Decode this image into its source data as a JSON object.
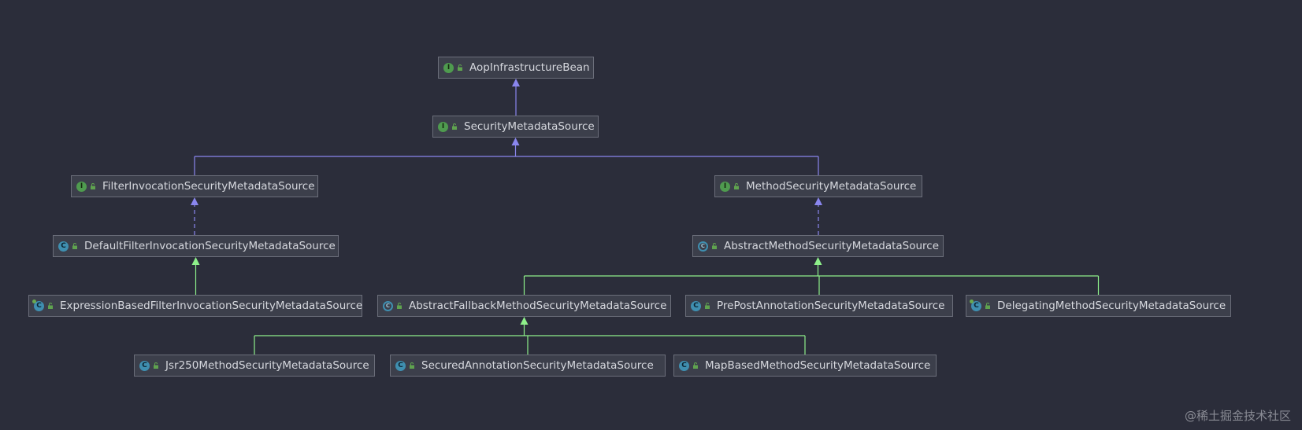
{
  "diagram": {
    "nodes": [
      {
        "id": "aop",
        "name": "AopInfrastructureBean",
        "kind": "interface",
        "kind_letter": "I"
      },
      {
        "id": "sms",
        "name": "SecurityMetadataSource",
        "kind": "interface",
        "kind_letter": "I"
      },
      {
        "id": "fism",
        "name": "FilterInvocationSecurityMetadataSource",
        "kind": "interface",
        "kind_letter": "I"
      },
      {
        "id": "msms",
        "name": "MethodSecurityMetadataSource",
        "kind": "interface",
        "kind_letter": "I"
      },
      {
        "id": "dfism",
        "name": "DefaultFilterInvocationSecurityMetadataSource",
        "kind": "class",
        "kind_letter": "C"
      },
      {
        "id": "amsms",
        "name": "AbstractMethodSecurityMetadataSource",
        "kind": "abstract",
        "kind_letter": "C"
      },
      {
        "id": "ebfism",
        "name": "ExpressionBasedFilterInvocationSecurityMetadataSource",
        "kind": "spring-class",
        "kind_letter": "C"
      },
      {
        "id": "afmsms",
        "name": "AbstractFallbackMethodSecurityMetadataSource",
        "kind": "abstract",
        "kind_letter": "C"
      },
      {
        "id": "ppasms",
        "name": "PrePostAnnotationSecurityMetadataSource",
        "kind": "class",
        "kind_letter": "C"
      },
      {
        "id": "dmsms",
        "name": "DelegatingMethodSecurityMetadataSource",
        "kind": "spring-class",
        "kind_letter": "C"
      },
      {
        "id": "jsr",
        "name": "Jsr250MethodSecurityMetadataSource",
        "kind": "class",
        "kind_letter": "C"
      },
      {
        "id": "sasms",
        "name": "SecuredAnnotationSecurityMetadataSource",
        "kind": "class",
        "kind_letter": "C"
      },
      {
        "id": "mbmsms",
        "name": "MapBasedMethodSecurityMetadataSource",
        "kind": "class",
        "kind_letter": "C"
      }
    ],
    "edges": [
      {
        "from": "sms",
        "to": "aop",
        "type": "extends-interface"
      },
      {
        "from": "fism",
        "to": "sms",
        "type": "extends-interface"
      },
      {
        "from": "msms",
        "to": "sms",
        "type": "extends-interface"
      },
      {
        "from": "dfism",
        "to": "fism",
        "type": "implements"
      },
      {
        "from": "amsms",
        "to": "msms",
        "type": "implements"
      },
      {
        "from": "ebfism",
        "to": "dfism",
        "type": "extends-class"
      },
      {
        "from": "afmsms",
        "to": "amsms",
        "type": "extends-class"
      },
      {
        "from": "ppasms",
        "to": "amsms",
        "type": "extends-class"
      },
      {
        "from": "dmsms",
        "to": "amsms",
        "type": "extends-class"
      },
      {
        "from": "jsr",
        "to": "afmsms",
        "type": "extends-class"
      },
      {
        "from": "sasms",
        "to": "afmsms",
        "type": "extends-class"
      },
      {
        "from": "mbmsms",
        "to": "afmsms",
        "type": "extends-class"
      }
    ],
    "colors": {
      "interface_edge": "#8a86ee",
      "class_edge": "#8ef08a",
      "visibility_lock": "#5fa34f"
    }
  },
  "watermark": "@稀土掘金技术社区"
}
